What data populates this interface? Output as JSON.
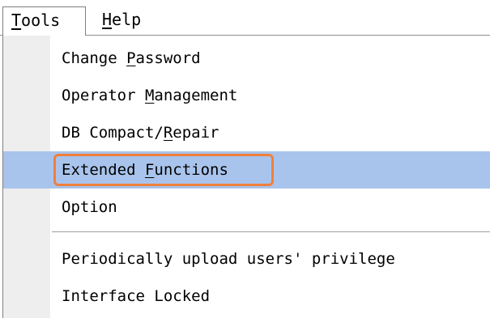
{
  "menubar": {
    "menus": [
      {
        "mnemonic": "T",
        "rest": "ools"
      },
      {
        "mnemonic": "H",
        "rest": "elp"
      }
    ]
  },
  "tools_menu": {
    "items": [
      {
        "before": "Change ",
        "mnemonic": "P",
        "after": "assword"
      },
      {
        "before": "Operator ",
        "mnemonic": "M",
        "after": "anagement"
      },
      {
        "before": "DB Compact/",
        "mnemonic": "R",
        "after": "epair"
      },
      {
        "before": "Extended ",
        "mnemonic": "F",
        "after": "unctions"
      },
      {
        "before": "Option",
        "mnemonic": "",
        "after": ""
      },
      {
        "before": "Periodically upload users' privilege",
        "mnemonic": "",
        "after": ""
      },
      {
        "before": "Interface Locked",
        "mnemonic": "",
        "after": ""
      }
    ]
  },
  "colors": {
    "highlight": "#a9c4ec",
    "focus_outline": "#f07f3c"
  }
}
